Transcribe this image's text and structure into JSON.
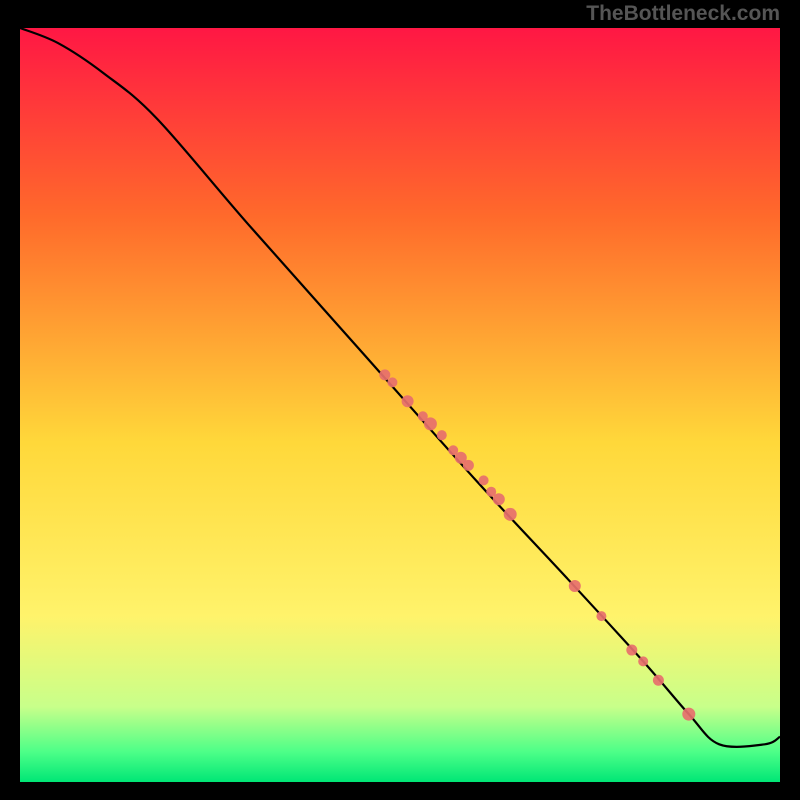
{
  "attribution": "TheBottleneck.com",
  "chart_data": {
    "type": "line",
    "title": "",
    "xlabel": "",
    "ylabel": "",
    "xlim": [
      0,
      100
    ],
    "ylim": [
      0,
      100
    ],
    "gradient_stops": [
      {
        "offset": 0,
        "color": "#ff1744"
      },
      {
        "offset": 25,
        "color": "#ff6a2b"
      },
      {
        "offset": 55,
        "color": "#ffd83a"
      },
      {
        "offset": 78,
        "color": "#fff36b"
      },
      {
        "offset": 90,
        "color": "#c8ff8a"
      },
      {
        "offset": 96,
        "color": "#4dff88"
      },
      {
        "offset": 100,
        "color": "#00e676"
      }
    ],
    "series": [
      {
        "name": "curve",
        "x": [
          0,
          5,
          11,
          18,
          30,
          45,
          60,
          72,
          82,
          88,
          92,
          98,
          100
        ],
        "y": [
          100,
          98,
          94,
          88,
          74,
          57,
          40,
          27,
          16,
          9,
          5,
          5,
          6
        ]
      }
    ],
    "scatter": {
      "name": "points",
      "color": "#e76f6c",
      "x": [
        48,
        49,
        51,
        53,
        54,
        55.5,
        57,
        58,
        59,
        61,
        62,
        63,
        64.5,
        73,
        76.5,
        80.5,
        82,
        84,
        88
      ],
      "y": [
        54,
        53,
        50.5,
        48.5,
        47.5,
        46,
        44,
        43,
        42,
        40,
        38.5,
        37.5,
        35.5,
        26,
        22,
        17.5,
        16,
        13.5,
        9
      ],
      "r": [
        5.5,
        5,
        6,
        5,
        6.5,
        5,
        5,
        6,
        5.5,
        5,
        5,
        6,
        6.5,
        6,
        5,
        5.5,
        5,
        5.5,
        6.5
      ]
    }
  }
}
